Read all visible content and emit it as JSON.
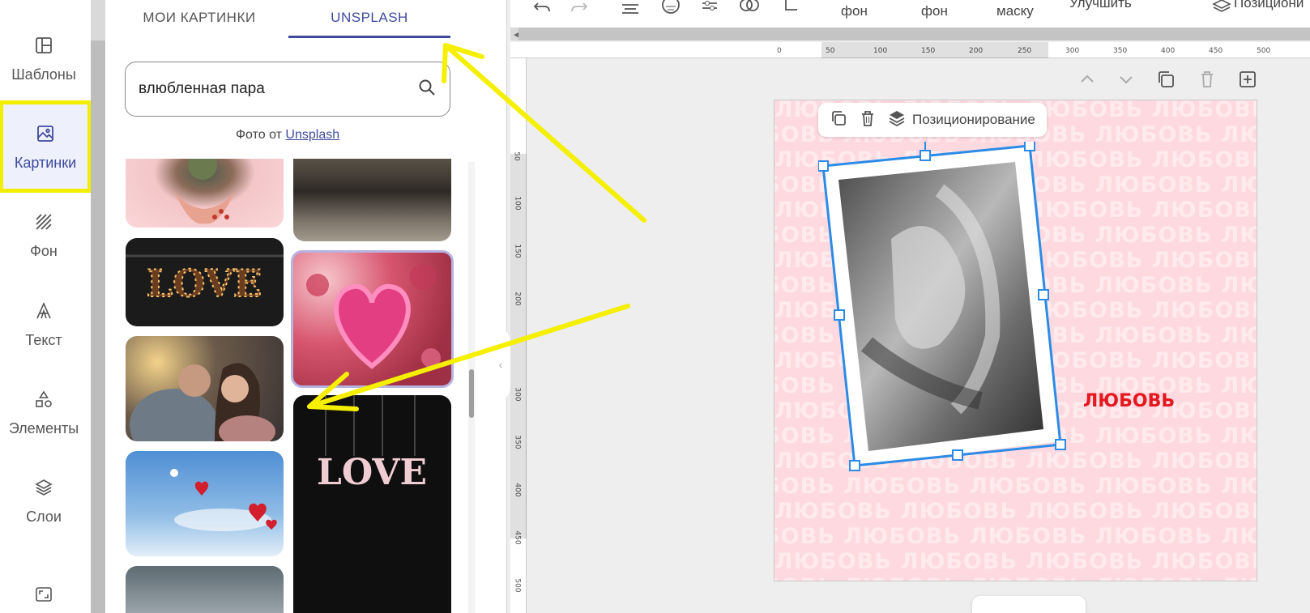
{
  "sidebar": {
    "items": [
      {
        "id": "templates",
        "label": "Шаблоны",
        "icon": "template-icon"
      },
      {
        "id": "images",
        "label": "Картинки",
        "icon": "image-icon",
        "active": true
      },
      {
        "id": "background",
        "label": "Фон",
        "icon": "hatch-icon"
      },
      {
        "id": "text",
        "label": "Текст",
        "icon": "text-icon"
      },
      {
        "id": "elements",
        "label": "Элементы",
        "icon": "shapes-icon"
      },
      {
        "id": "layers",
        "label": "Слои",
        "icon": "layers-icon"
      },
      {
        "id": "resize",
        "label": "",
        "icon": "resize-icon"
      }
    ]
  },
  "panel": {
    "tabs": [
      {
        "label": "МОИ КАРТИНКИ"
      },
      {
        "label": "UNSPLASH",
        "active": true
      }
    ],
    "search": {
      "value": "влюбленная пара"
    },
    "credit_prefix": "Фото от",
    "credit_link": "Unsplash",
    "thumbnails": [
      {
        "name": "hands-flower-photo",
        "text": ""
      },
      {
        "name": "blurred-road-photo",
        "text": ""
      },
      {
        "name": "love-marquee-photo",
        "text": "LOVE"
      },
      {
        "name": "pink-heart-photo",
        "text": ""
      },
      {
        "name": "couple-photo",
        "text": ""
      },
      {
        "name": "hanging-love-photo",
        "text": "LOVE"
      },
      {
        "name": "heart-balloons-photo",
        "text": ""
      },
      {
        "name": "grey-sky-photo",
        "text": ""
      }
    ]
  },
  "toolbar": {
    "fon1": "фон",
    "fon2": "фон",
    "mask": "маску",
    "enhance": "Улучшить",
    "position": "Позициони"
  },
  "ruler": {
    "h": [
      "0",
      "50",
      "100",
      "150",
      "200",
      "250",
      "300",
      "350",
      "400",
      "450",
      "500"
    ],
    "v": [
      "50",
      "100",
      "150",
      "200",
      "300",
      "350",
      "400",
      "450",
      "500"
    ]
  },
  "canvas": {
    "bg_word": "ЛЮБОВЬ",
    "red_word": "ЛЮБОВЬ",
    "context_menu": {
      "positioning": "Позиционирование"
    }
  },
  "colors": {
    "accent": "#3f4a9e",
    "highlight": "#f2ee00",
    "selection": "#2b8be6",
    "red": "#e4191f",
    "artboard": "#ffd9e0"
  }
}
